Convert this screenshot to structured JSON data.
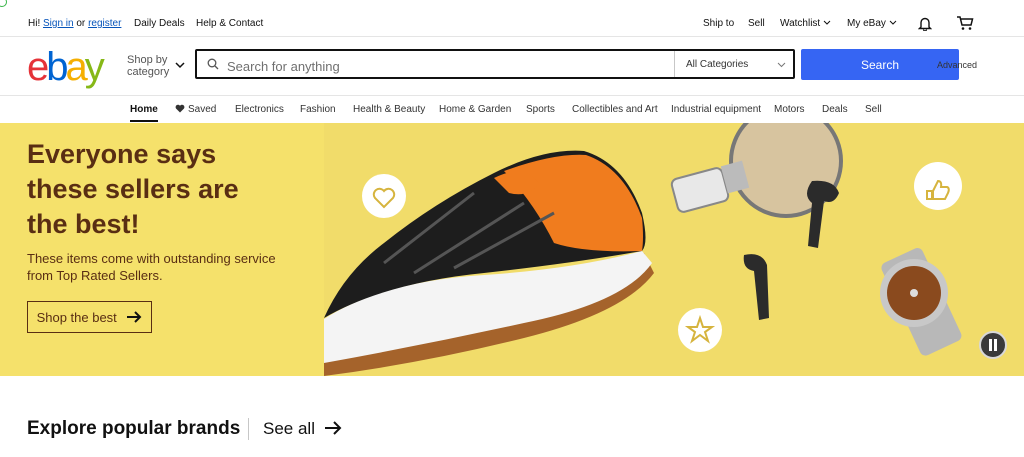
{
  "topbar": {
    "greeting": "Hi!",
    "sign_in": "Sign in",
    "or": "or",
    "register": "register",
    "daily_deals": "Daily Deals",
    "help_contact": "Help & Contact",
    "ship_to": "Ship to",
    "sell": "Sell",
    "watchlist": "Watchlist",
    "my_ebay": "My eBay"
  },
  "header": {
    "logo": [
      "e",
      "b",
      "a",
      "y"
    ],
    "logo_colors": [
      "#e53238",
      "#0064d2",
      "#f5af02",
      "#86b817"
    ],
    "shop_by_line1": "Shop by",
    "shop_by_line2": "category",
    "search_placeholder": "Search for anything",
    "category_selected": "All Categories",
    "search_button": "Search",
    "advanced": "Advanced"
  },
  "nav": {
    "items": [
      "Home",
      "Saved",
      "Electronics",
      "Fashion",
      "Health & Beauty",
      "Home & Garden",
      "Sports",
      "Collectibles and Art",
      "Industrial equipment",
      "Motors",
      "Deals",
      "Sell"
    ],
    "active": "Home"
  },
  "hero": {
    "title": "Everyone says these sellers are the best!",
    "subtitle": "These items come with outstanding service from Top Rated Sellers.",
    "button": "Shop the best",
    "background": "#f5e16b",
    "text_color": "#592e13"
  },
  "explore": {
    "heading": "Explore popular brands",
    "see_all": "See all"
  },
  "colors": {
    "accent": "#3665f3",
    "link": "#0654ba"
  }
}
